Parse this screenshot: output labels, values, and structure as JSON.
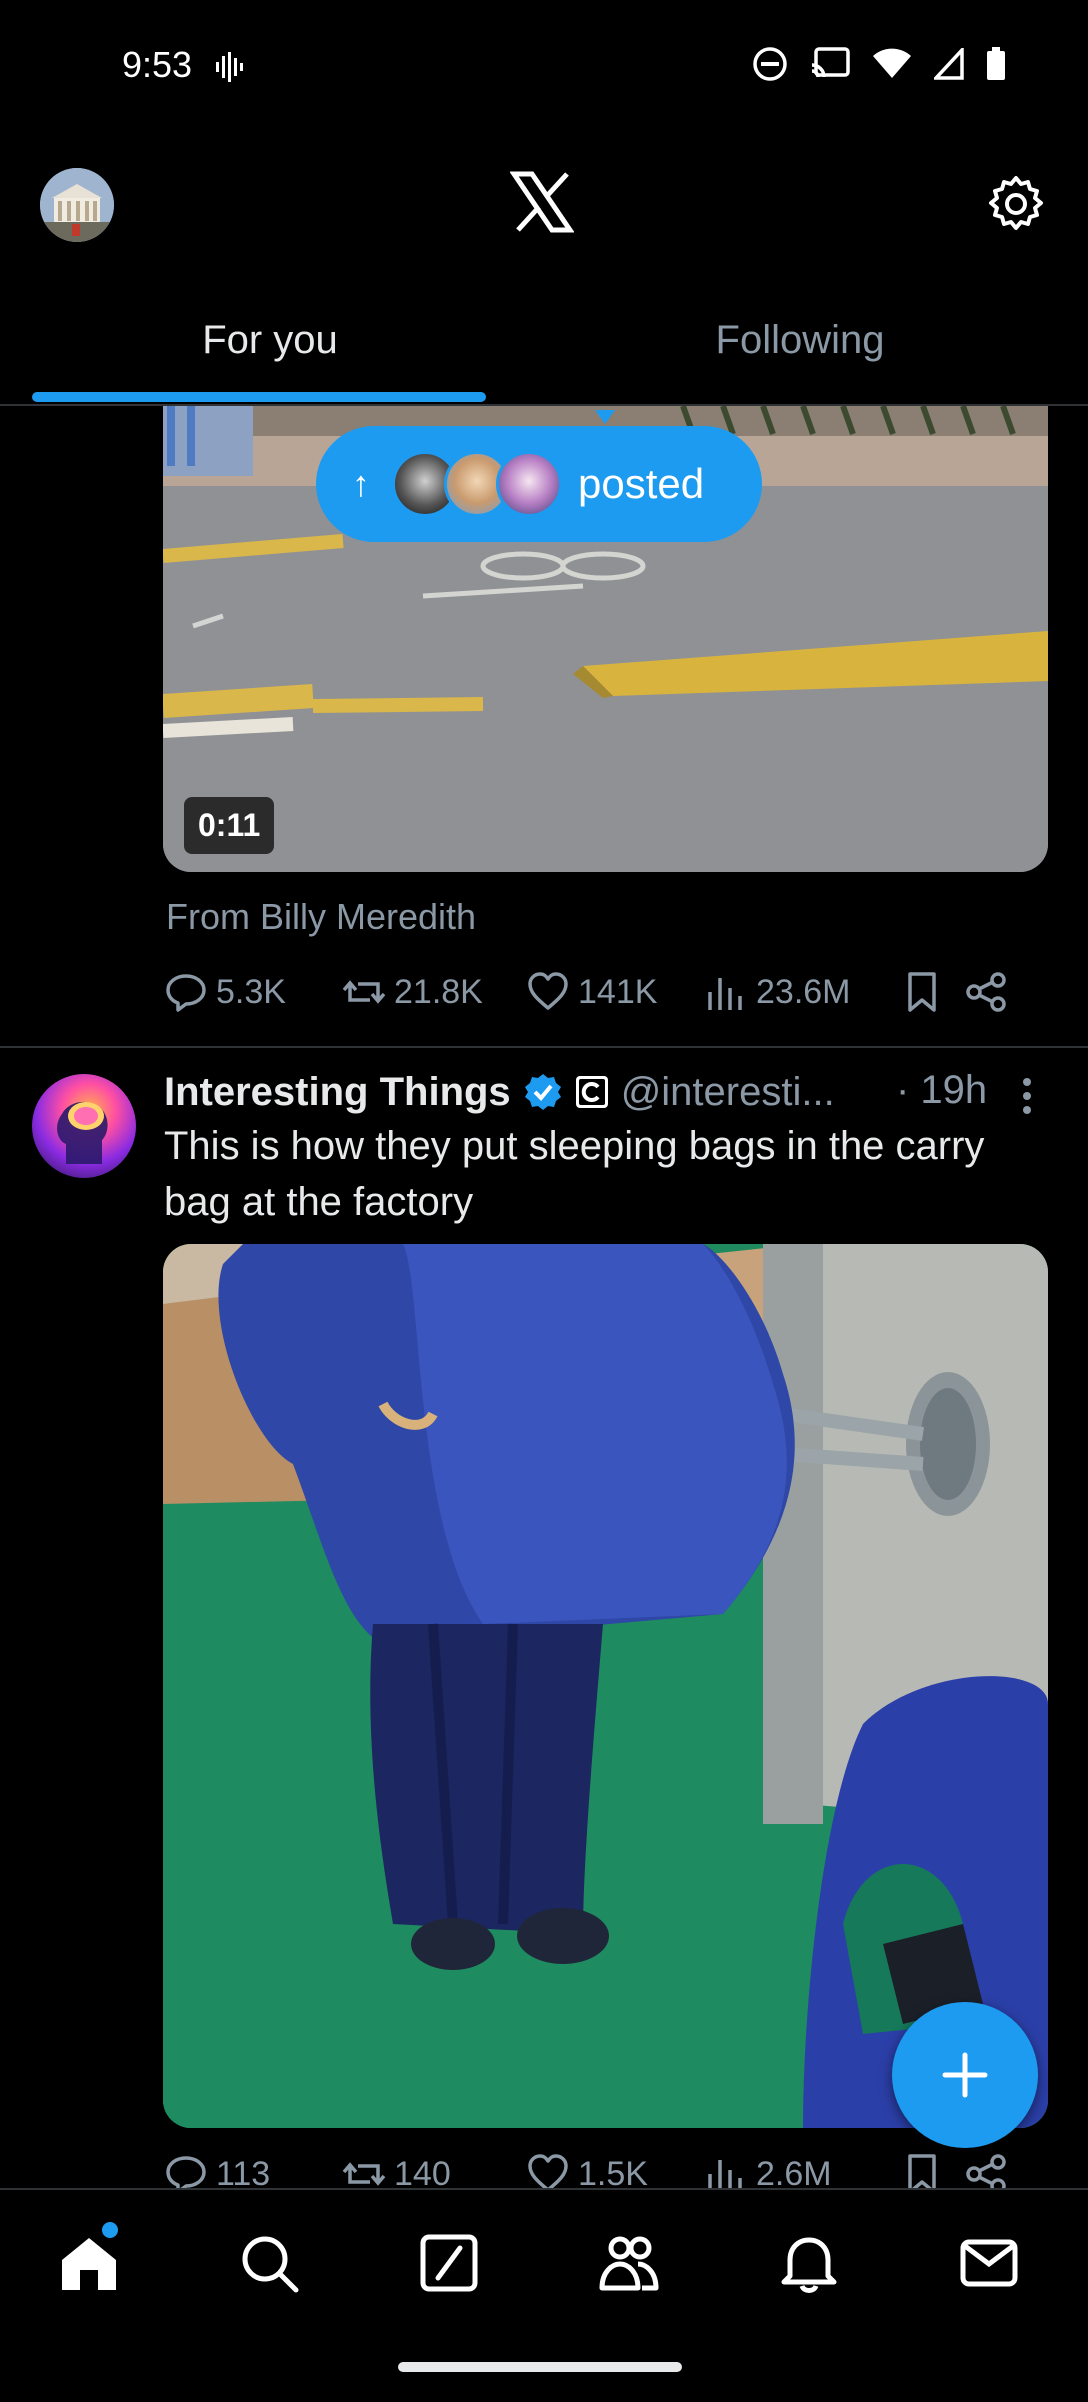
{
  "status_bar": {
    "time": "9:53"
  },
  "header": {
    "logo_icon": "x-logo-icon",
    "settings_icon": "gear-icon"
  },
  "tabs": [
    {
      "label": "For you",
      "active": true
    },
    {
      "label": "Following",
      "active": false
    }
  ],
  "posts": [
    {
      "video_duration": "0:11",
      "from_line": "From Billy Meredith",
      "stats": {
        "replies": "5.3K",
        "reposts": "21.8K",
        "likes": "141K",
        "views": "23.6M"
      }
    },
    {
      "author_name": "Interesting Things",
      "handle": "@interesti...",
      "time": "· 19h",
      "text": "This is how they put sleeping bags in the carry bag at the factory",
      "stats": {
        "replies": "113",
        "reposts": "140",
        "likes": "1.5K",
        "views": "2.6M"
      }
    }
  ],
  "new_posts_pill": {
    "label": "posted"
  },
  "colors": {
    "accent": "#1d9bf0",
    "background": "#000000",
    "text_primary": "#e7e9ea",
    "text_secondary": "#8b98a5"
  },
  "bottom_nav": [
    "home-icon",
    "search-icon",
    "grok-icon",
    "communities-icon",
    "notifications-icon",
    "messages-icon"
  ]
}
